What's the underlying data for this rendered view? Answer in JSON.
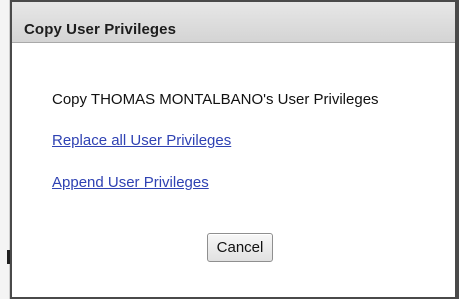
{
  "dialog": {
    "title": "Copy User Privileges",
    "message": "Copy THOMAS MONTALBANO's User Privileges",
    "options": [
      {
        "label": "Replace all User Privileges"
      },
      {
        "label": "Append User Privileges"
      }
    ],
    "cancel_label": "Cancel"
  },
  "colors": {
    "link": "#2f42b3",
    "title_bar": "#d9d9d9",
    "border": "#4a4a4a"
  }
}
